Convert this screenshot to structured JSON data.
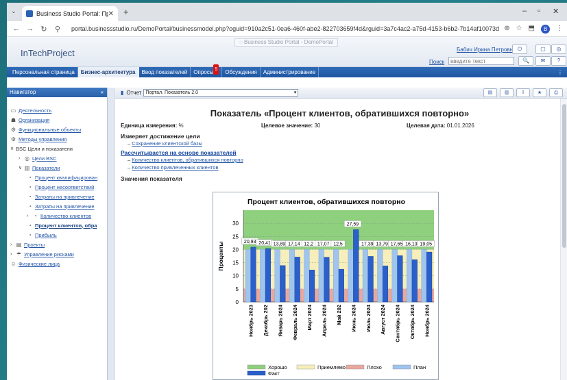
{
  "browser": {
    "tab_title": "Business Studio Portal: Процесс",
    "url": "portal.businessstudio.ru/DemoPortal/businessmodel.php?oguid=910a2c51-0ea6-460f-abe2-822703659f4d&rguid=3a7c4ac2-a75d-4153-b6b2-7b14af10073d",
    "profile_letter": "B"
  },
  "portal": {
    "tag": "Business Studio Portal - DemoPortal",
    "brand": "InTechProject",
    "user": "Бабич Ирина Петровна",
    "search_label": "Поиск",
    "search_placeholder": "введите текст"
  },
  "menu": {
    "items": [
      "Персональная страница",
      "Бизнес-архитектура",
      "Ввод показателей",
      "Опросы",
      "Обсуждения",
      "Администрирование"
    ],
    "active_index": 1,
    "polls_badge": "5"
  },
  "navigator": {
    "title": "Навигатор",
    "items": [
      {
        "label": "Деятельность",
        "level": 0,
        "arrow": "",
        "icon": "folder-icon",
        "glyph": "▭"
      },
      {
        "label": "Организация",
        "level": 0,
        "arrow": "",
        "icon": "org-icon",
        "glyph": "☗"
      },
      {
        "label": "Функциональные объекты",
        "level": 0,
        "arrow": "",
        "icon": "objects-icon",
        "glyph": "⚙"
      },
      {
        "label": "Методы управления",
        "level": 0,
        "arrow": "",
        "icon": "methods-icon",
        "glyph": "⚙"
      },
      {
        "label": "BSC Цели и показатели",
        "level": 0,
        "arrow": "∨",
        "icon": "",
        "glyph": "",
        "plain": true
      },
      {
        "label": "Цели BSC",
        "level": 1,
        "arrow": "›",
        "icon": "target-icon",
        "glyph": "◎"
      },
      {
        "label": "Показатели",
        "level": 1,
        "arrow": "∨",
        "icon": "indicators-icon",
        "glyph": "▥"
      },
      {
        "label": "Процент квалифицирован",
        "level": 2,
        "arrow": "",
        "icon": "indicator-icon",
        "glyph": "◔"
      },
      {
        "label": "Процент несоответствий",
        "level": 2,
        "arrow": "",
        "icon": "indicator-icon",
        "glyph": "◔"
      },
      {
        "label": "Затраты на привлечение",
        "level": 2,
        "arrow": "",
        "icon": "indicator-icon",
        "glyph": "◔"
      },
      {
        "label": "Затраты на привлечение",
        "level": 2,
        "arrow": "",
        "icon": "indicator-icon",
        "glyph": "◔"
      },
      {
        "label": "Количество клиентов",
        "level": 2,
        "arrow": "›",
        "icon": "indicator-icon",
        "glyph": "◔"
      },
      {
        "label": "Процент клиентов, обра",
        "level": 2,
        "arrow": "",
        "icon": "indicator-icon",
        "glyph": "◔",
        "bold": true
      },
      {
        "label": "Прибыль",
        "level": 2,
        "arrow": "",
        "icon": "indicator-icon",
        "glyph": "◔"
      },
      {
        "label": "Проекты",
        "level": 0,
        "arrow": "›",
        "icon": "projects-icon",
        "glyph": "▤"
      },
      {
        "label": "Управление рисками",
        "level": 0,
        "arrow": "›",
        "icon": "risk-icon",
        "glyph": "☂"
      },
      {
        "label": "Физические лица",
        "level": 0,
        "arrow": "",
        "icon": "person-icon",
        "glyph": "☺"
      }
    ]
  },
  "report": {
    "label": "Отчет",
    "selected": "Портал. Показатель 2.0"
  },
  "indicator": {
    "title": "Показатель «Процент клиентов, обратившихся повторно»",
    "unit_label": "Единица измерения:",
    "unit_value": "%",
    "target_label": "Целевое значение:",
    "target_value": "30",
    "date_label": "Целевая дата:",
    "date_value": "01.01.2026",
    "measures_title": "Измеряет достижение цели",
    "measures_items": [
      "Сохранение клиентской базы"
    ],
    "calc_title": "Рассчитывается на основе показателей",
    "calc_items": [
      "Количество клиентов, обратившихся повторно",
      "Количество привлеченных клиентов"
    ],
    "values_title": "Значения показателя"
  },
  "chart_data": {
    "type": "bar",
    "title": "Процент клиентов, обратившихся повторно",
    "ylabel": "Проценты",
    "xlabel": "",
    "ylim": [
      0,
      35
    ],
    "yticks": [
      0,
      5,
      10,
      15,
      20,
      25,
      30
    ],
    "grid": true,
    "legend_position": "bottom",
    "categories": [
      "Ноябрь 2023",
      "Декабрь 202",
      "Январь 2024",
      "Февраль 2024",
      "Март 2024",
      "Апрель 2024",
      "Май 202",
      "Июнь 2024",
      "Июль 2024",
      "Август 2024",
      "Сентябрь 2024",
      "Октябрь 2024",
      "Ноябрь 2024"
    ],
    "bands": [
      {
        "name": "Хорошо",
        "from": 20,
        "to": 35,
        "color": "#8fd07f"
      },
      {
        "name": "Приемлемо",
        "from": 5,
        "to": 20,
        "color": "#f6eebb"
      },
      {
        "name": "Плохо",
        "from": 0,
        "to": 5,
        "color": "#e9a89f"
      }
    ],
    "series": [
      {
        "name": "План",
        "values": [
          20,
          20,
          20,
          20,
          20,
          20,
          20,
          20,
          20,
          20,
          20,
          20,
          20
        ],
        "color": "#9fc4ee"
      },
      {
        "name": "Факт",
        "values": [
          20.93,
          20.41,
          13.89,
          17.14,
          12.2,
          17.07,
          12.5,
          27.59,
          17.39,
          13.79,
          17.65,
          16.13,
          19.05
        ],
        "color": "#2b5fc9"
      }
    ],
    "data_labels": [
      "20,93",
      "20,41",
      "13,89",
      "17,14",
      "12,2",
      "17,07",
      "12,5",
      "27,59",
      "17,39",
      "13,79",
      "17,65",
      "16,13",
      "19,05"
    ]
  }
}
